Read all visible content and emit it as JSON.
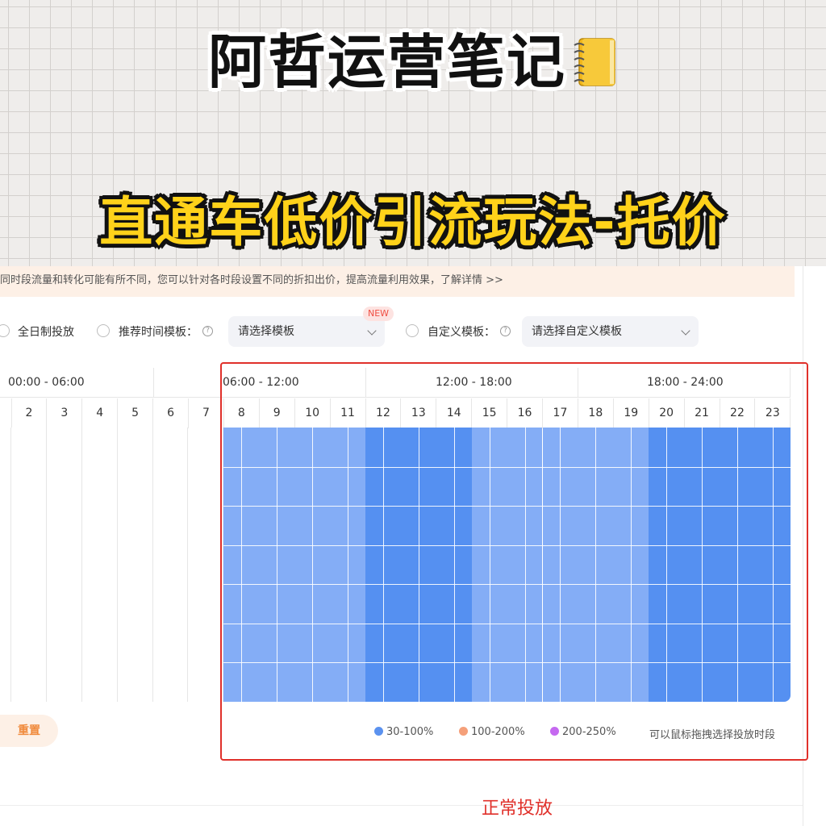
{
  "banner": {
    "title": "阿哲运营笔记",
    "icon": "notebook-icon",
    "subtitle": "直通车低价引流玩法-托价"
  },
  "tip": {
    "text": "同时段流量和转化可能有所不同，您可以针对各时段设置不同的折扣出价，提高流量利用效果，了解详情 >>"
  },
  "options": {
    "all_day_label": "全日制投放",
    "recommended_label": "推荐时间模板：",
    "recommended_placeholder": "请选择模板",
    "new_badge": "NEW",
    "custom_label": "自定义模板：",
    "custom_placeholder": "请选择自定义模板",
    "help_glyph": "?"
  },
  "grid": {
    "ranges": [
      "00:00 - 06:00",
      "06:00 - 12:00",
      "12:00 - 18:00",
      "18:00 - 24:00"
    ],
    "hours": [
      "2",
      "3",
      "4",
      "5",
      "6",
      "7",
      "8",
      "9",
      "10",
      "11",
      "12",
      "13",
      "14",
      "15",
      "16",
      "17",
      "18",
      "19",
      "20",
      "21",
      "22",
      "23"
    ],
    "colors": {
      "light": "#bcd5fb",
      "medium": "#84adf6",
      "strong": "#5590f1"
    },
    "hour_levels": {
      "0": "light",
      "1": "none",
      "2": "none",
      "3": "none",
      "4": "none",
      "5": "none",
      "6": "none",
      "7": "none",
      "8": "medium",
      "9": "medium",
      "10": "medium",
      "11": "medium",
      "12": "strong",
      "13": "strong",
      "14": "strong",
      "15": "medium",
      "16": "medium",
      "17": "medium",
      "18": "medium",
      "19": "medium",
      "20": "strong",
      "21": "strong",
      "22": "strong",
      "23": "strong"
    }
  },
  "legend": {
    "items": [
      {
        "label": "30-100%",
        "color": "#5b92ef"
      },
      {
        "label": "100-200%",
        "color": "#f5a07a"
      },
      {
        "label": "200-250%",
        "color": "#c569f0"
      }
    ],
    "hint": "可以鼠标拖拽选择投放时段"
  },
  "buttons": {
    "reset": "重置"
  },
  "status": {
    "text": "正常投放"
  }
}
